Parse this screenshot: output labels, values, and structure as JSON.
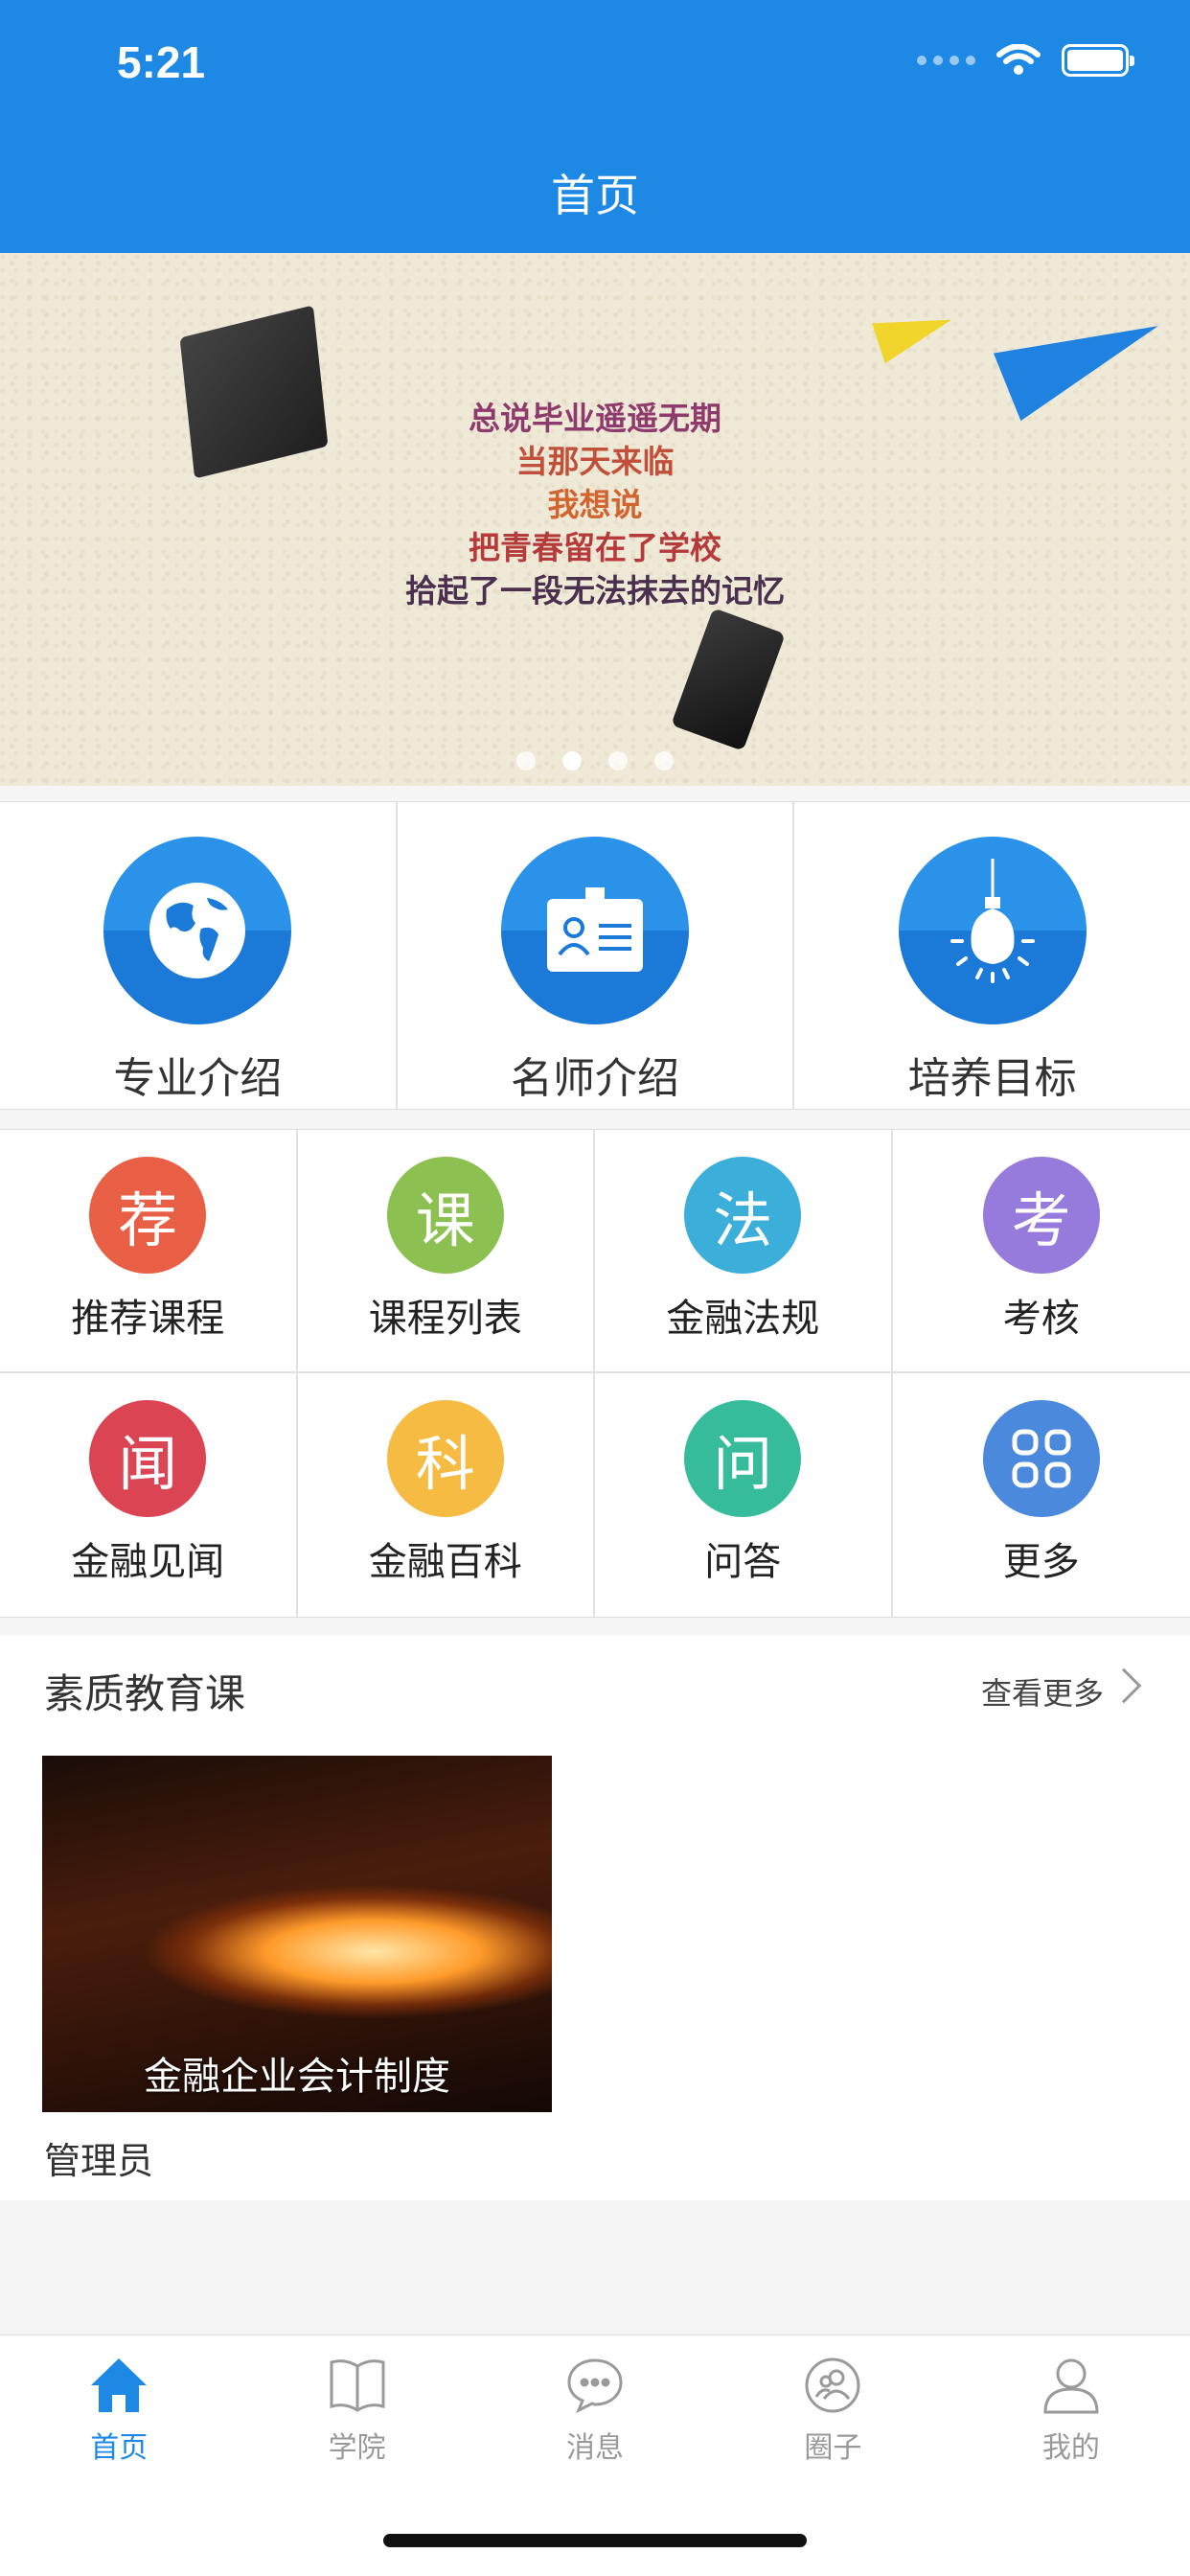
{
  "status_bar": {
    "time": "5:21"
  },
  "header": {
    "title": "首页"
  },
  "banner": {
    "lines": [
      "总说毕业遥遥无期",
      "当那天来临",
      "我想说",
      "把青春留在了学校",
      "拾起了一段无法抹去的记忆"
    ],
    "active_index": 1,
    "dot_count": 4
  },
  "features": [
    {
      "label": "专业介绍",
      "icon": "globe-icon"
    },
    {
      "label": "名师介绍",
      "icon": "id-card-icon"
    },
    {
      "label": "培养目标",
      "icon": "lightbulb-icon"
    }
  ],
  "menu": [
    {
      "char": "荐",
      "label": "推荐课程",
      "color": "#e95f46"
    },
    {
      "char": "课",
      "label": "课程列表",
      "color": "#8cc152"
    },
    {
      "char": "法",
      "label": "金融法规",
      "color": "#3bafda"
    },
    {
      "char": "考",
      "label": "考核",
      "color": "#967adc"
    },
    {
      "char": "闻",
      "label": "金融见闻",
      "color": "#da4453"
    },
    {
      "char": "科",
      "label": "金融百科",
      "color": "#f6bb42"
    },
    {
      "char": "问",
      "label": "问答",
      "color": "#37bc9b"
    },
    {
      "char": "",
      "label": "更多",
      "color": "#4a89dc"
    }
  ],
  "section": {
    "title": "素质教育课",
    "see_more": "查看更多",
    "course": {
      "title": "金融企业会计制度",
      "author": "管理员"
    }
  },
  "tabs": [
    {
      "label": "首页",
      "icon": "home-icon",
      "active": true
    },
    {
      "label": "学院",
      "icon": "book-icon",
      "active": false
    },
    {
      "label": "消息",
      "icon": "chat-icon",
      "active": false
    },
    {
      "label": "圈子",
      "icon": "group-icon",
      "active": false
    },
    {
      "label": "我的",
      "icon": "user-icon",
      "active": false
    }
  ]
}
